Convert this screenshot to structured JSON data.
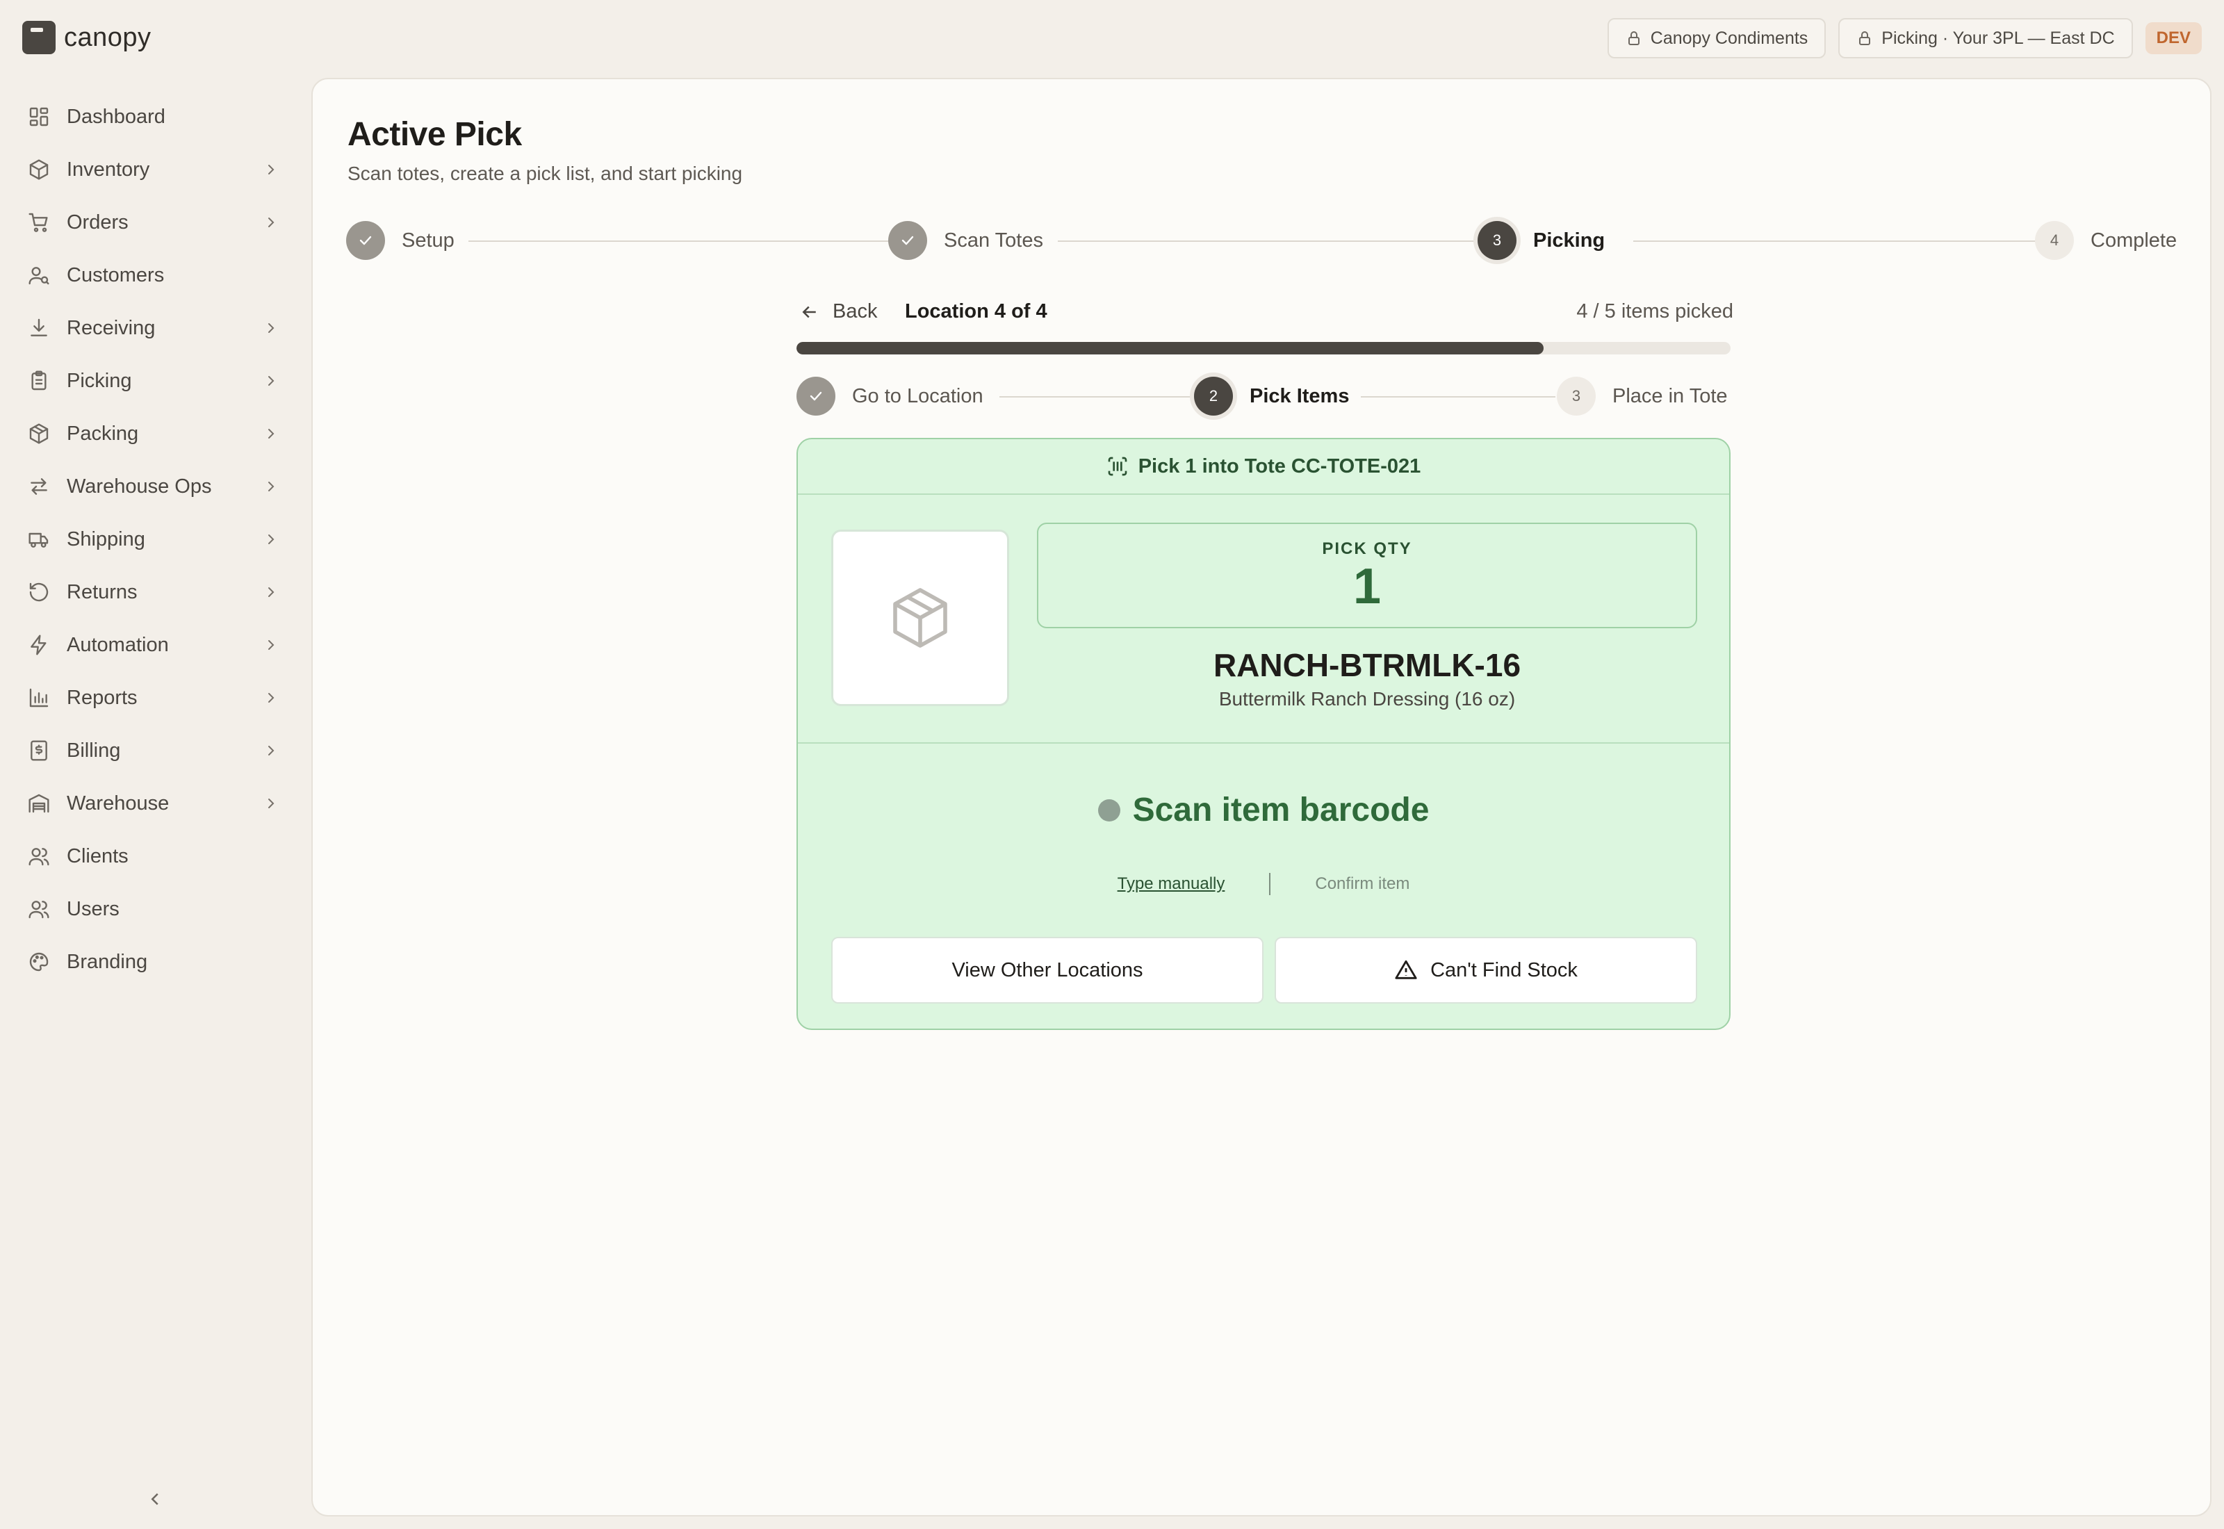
{
  "app": {
    "logo_text": "canopy"
  },
  "topbar": {
    "client_pill": "Canopy Condiments",
    "context_pill": "Picking · Your 3PL — East DC",
    "env_badge": "DEV"
  },
  "sidebar": {
    "items": [
      {
        "label": "Dashboard",
        "icon": "dashboard-icon",
        "chevron": false
      },
      {
        "label": "Inventory",
        "icon": "box-icon",
        "chevron": true
      },
      {
        "label": "Orders",
        "icon": "cart-icon",
        "chevron": true
      },
      {
        "label": "Customers",
        "icon": "customer-icon",
        "chevron": false
      },
      {
        "label": "Receiving",
        "icon": "download-icon",
        "chevron": true
      },
      {
        "label": "Picking",
        "icon": "clipboard-icon",
        "chevron": true
      },
      {
        "label": "Packing",
        "icon": "package-icon",
        "chevron": true
      },
      {
        "label": "Warehouse Ops",
        "icon": "arrows-icon",
        "chevron": true
      },
      {
        "label": "Shipping",
        "icon": "truck-icon",
        "chevron": true
      },
      {
        "label": "Returns",
        "icon": "rotate-icon",
        "chevron": true
      },
      {
        "label": "Automation",
        "icon": "lightning-icon",
        "chevron": true
      },
      {
        "label": "Reports",
        "icon": "bar-chart-icon",
        "chevron": true
      },
      {
        "label": "Billing",
        "icon": "receipt-icon",
        "chevron": true
      },
      {
        "label": "Warehouse",
        "icon": "warehouse-icon",
        "chevron": true
      },
      {
        "label": "Clients",
        "icon": "users-icon",
        "chevron": false
      },
      {
        "label": "Users",
        "icon": "users-icon",
        "chevron": false
      },
      {
        "label": "Branding",
        "icon": "palette-icon",
        "chevron": false
      }
    ]
  },
  "page": {
    "title": "Active Pick",
    "subtitle": "Scan totes, create a pick list, and start picking"
  },
  "stepper": {
    "steps": [
      {
        "label": "Setup",
        "state": "done",
        "number": "1"
      },
      {
        "label": "Scan Totes",
        "state": "done",
        "number": "2"
      },
      {
        "label": "Picking",
        "state": "active",
        "number": "3"
      },
      {
        "label": "Complete",
        "state": "todo",
        "number": "4"
      }
    ]
  },
  "pick": {
    "back_label": "Back",
    "location_label": "Location 4 of 4",
    "items_picked": "4 / 5 items picked",
    "progress_fraction": 0.8,
    "substeps": [
      {
        "label": "Go to Location",
        "state": "done",
        "number": "1"
      },
      {
        "label": "Pick Items",
        "state": "active",
        "number": "2"
      },
      {
        "label": "Place in Tote",
        "state": "todo",
        "number": "3"
      }
    ],
    "card": {
      "header": "Pick 1 into Tote CC-TOTE-021",
      "qty_label": "PICK QTY",
      "qty_value": "1",
      "sku": "RANCH-BTRMLK-16",
      "product_name": "Buttermilk Ranch Dressing (16 oz)",
      "scan_prompt": "Scan item barcode",
      "type_manually": "Type manually",
      "confirm_item": "Confirm item",
      "view_other_locations": "View Other Locations",
      "cant_find_stock": "Can't Find Stock"
    }
  },
  "colors": {
    "accent_dark": "#4a4641",
    "card_bg": "#dcf6df",
    "card_border": "#9fd1a6",
    "success_text": "#2f6a3a",
    "dev_badge": "#c0662e"
  }
}
